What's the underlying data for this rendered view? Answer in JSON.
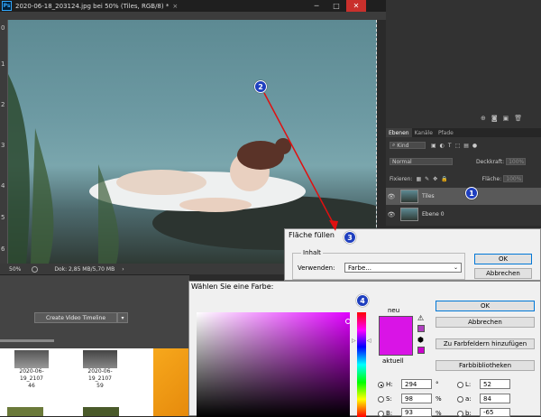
{
  "window": {
    "tab_title": "2020-06-18_203124.jpg bei 50% (Tiles, RGB/8) *",
    "app_icon": "Ps",
    "minimize": "─",
    "maximize": "□",
    "close": "✕"
  },
  "ruler_numbers": [
    "0",
    "1",
    "2",
    "3",
    "4",
    "5",
    "6"
  ],
  "status": {
    "zoom": "50%",
    "doc": "Dok: 2,85 MB/5,70 MB"
  },
  "timeline": {
    "button": "Create Video Timeline",
    "dropdown": "▾"
  },
  "explorer": {
    "items": [
      {
        "label_1": "2020-06-19_2107",
        "label_2": "46"
      },
      {
        "label_1": "2020-06-19_2107",
        "label_2": "59"
      }
    ]
  },
  "layers_panel": {
    "tabs": [
      "Ebenen",
      "Kanäle",
      "Pfade"
    ],
    "kind_label": "Kind",
    "blend_mode": "Normal",
    "opacity_label": "Deckkraft:",
    "opacity_value": "100%",
    "lock_label": "Fixieren:",
    "fill_label": "Fläche:",
    "fill_value": "100%",
    "layers": [
      {
        "name": "Tiles",
        "active": true
      },
      {
        "name": "Ebene 0",
        "active": false
      }
    ]
  },
  "fill_dialog": {
    "title": "Fläche füllen",
    "group": "Inhalt",
    "use_label": "Verwenden:",
    "use_value": "Farbe...",
    "ok": "OK",
    "cancel": "Abbrechen"
  },
  "color_picker": {
    "title": "Wählen Sie eine Farbe:",
    "new_label": "neu",
    "current_label": "aktuell",
    "new_color": "#d914e6",
    "ok": "OK",
    "cancel": "Abbrechen",
    "add_swatches": "Zu Farbfeldern hinzufügen",
    "libraries": "Farbbibliotheken",
    "h_label": "H:",
    "h_value": "294",
    "h_unit": "°",
    "s_label": "S:",
    "s_value": "98",
    "s_unit": "%",
    "b_label": "B:",
    "b_value": "93",
    "b_unit": "%",
    "l_label": "L:",
    "l_value": "52",
    "a_label": "a:",
    "a_value": "84",
    "bb_label": "b:",
    "bb_value": "-65"
  },
  "annotations": [
    "1",
    "2",
    "3",
    "4"
  ],
  "colors": {
    "badge": "#1f3fbf",
    "arrow": "#e01010"
  }
}
